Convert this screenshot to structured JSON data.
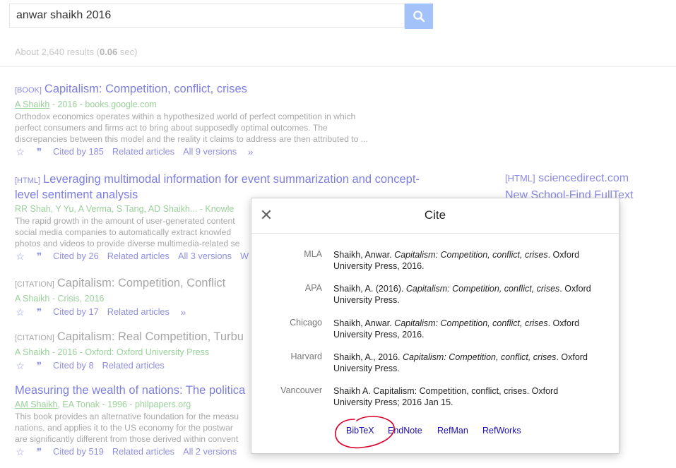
{
  "search": {
    "query": "anwar shaikh 2016",
    "stats_prefix": "About 2,640 results (",
    "stats_time": "0.06",
    "stats_suffix": " sec)"
  },
  "results": [
    {
      "type": "[BOOK]",
      "title": "Capitalism: Competition, conflict, crises",
      "author": "A Shaikh",
      "meta": " - 2016 - books.google.com",
      "snippet": [
        "Orthodox economics operates within a hypothesized world of perfect competition in which",
        "perfect consumers and firms act to bring about supposedly optimal outcomes. The",
        "discrepancies between this model and the reality it claims to address are then attributed to ..."
      ],
      "cited": "Cited by 185",
      "related": "Related articles",
      "versions": "All 9 versions"
    },
    {
      "type": "[HTML]",
      "title_line1": "Leveraging multimodal information for event summarization and concept-",
      "title_line2": "level sentiment analysis",
      "meta_authors": "RR Shah, Y Yu, A Verma, S Tang, AD Shaikh... - Knowle",
      "snippet": [
        "The rapid growth in the amount of user-generated content",
        "social media companies to automatically extract knowled",
        "photos and videos to provide diverse multimedia-related se"
      ],
      "cited": "Cited by 26",
      "related": "Related articles",
      "versions": "All 3 versions",
      "more": "W"
    },
    {
      "type": "[CITATION]",
      "title": "Capitalism: Competition, Conflict",
      "meta": "A Shaikh - Crisis, 2016",
      "cited": "Cited by 17",
      "related": "Related articles"
    },
    {
      "type": "[CITATION]",
      "title": "Capitalism: Real Competition, Turbu",
      "meta": "A Shaikh - 2016 - Oxford: Oxford University Press",
      "cited": "Cited by 8",
      "related": "Related articles"
    },
    {
      "title": "Measuring the wealth of nations: The politica",
      "author": "AM Shaikh",
      "meta": ", EA Tonak - 1996 - philpapers.org",
      "snippet": [
        "This book provides an alternative foundation for the measu",
        "nations, and applies it to the US economy for the postwar",
        "are significantly different from those derived within convent"
      ],
      "cited": "Cited by 519",
      "related": "Related articles",
      "versions": "All 2 versions"
    }
  ],
  "side": {
    "type": "[HTML]",
    "domain": "sciencedirect.com",
    "findtext": "New School-Find FullText"
  },
  "modal": {
    "title": "Cite",
    "citations": [
      {
        "style": "MLA",
        "pre": "Shaikh, Anwar. ",
        "ital": "Capitalism: Competition, conflict, crises",
        "post": ". Oxford University Press, 2016."
      },
      {
        "style": "APA",
        "pre": "Shaikh, A. (2016). ",
        "ital": "Capitalism: Competition, conflict, crises",
        "post": ". Oxford University Press."
      },
      {
        "style": "Chicago",
        "pre": "Shaikh, Anwar. ",
        "ital": "Capitalism: Competition, conflict, crises",
        "post": ". Oxford University Press, 2016."
      },
      {
        "style": "Harvard",
        "pre": "Shaikh, A., 2016. ",
        "ital": "Capitalism: Competition, conflict, crises",
        "post": ". Oxford University Press."
      },
      {
        "style": "Vancouver",
        "pre": "Shaikh A. Capitalism: Competition, conflict, crises. Oxford University Press; 2016 Jan 15.",
        "ital": "",
        "post": ""
      }
    ],
    "exports": [
      "BibTeX",
      "EndNote",
      "RefMan",
      "RefWorks"
    ]
  },
  "colors": {
    "accent": "#7d7ee0",
    "meta_green": "#9ad19a",
    "search_button": "#a3c2f9",
    "circle_annotation": "#d8002a"
  }
}
